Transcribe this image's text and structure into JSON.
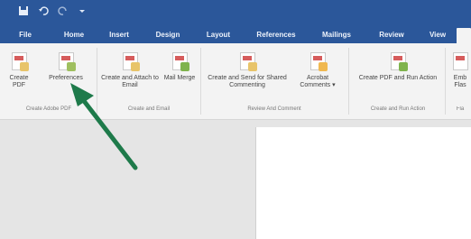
{
  "window": {
    "qat_icons": [
      "save-icon",
      "undo-icon",
      "redo-icon",
      "customize-icon"
    ]
  },
  "tabs": [
    {
      "label": "File",
      "active": false
    },
    {
      "label": "Home",
      "active": false
    },
    {
      "label": "Insert",
      "active": false
    },
    {
      "label": "Design",
      "active": false
    },
    {
      "label": "Layout",
      "active": false
    },
    {
      "label": "References",
      "active": false
    },
    {
      "label": "Mailings",
      "active": false
    },
    {
      "label": "Review",
      "active": false
    },
    {
      "label": "View",
      "active": false
    },
    {
      "label": "",
      "active": true
    }
  ],
  "ribbon": {
    "buttons": {
      "create_pdf": "Create PDF",
      "preferences": "Preferences",
      "create_attach_email": "Create and Attach to Email",
      "mail_merge": "Mail Merge",
      "create_send_commenting": "Create and Send for Shared Commenting",
      "acrobat_comments": "Acrobat Comments ▾",
      "create_pdf_run_action": "Create PDF and Run Action",
      "embed_flash": "Emb Flas"
    },
    "groups": {
      "create_adobe_pdf": "Create Adobe PDF",
      "create_and_email": "Create and Email",
      "review_and_comment": "Review And Comment",
      "create_and_run_action": "Create and Run Action",
      "flash": "Fla"
    }
  },
  "colors": {
    "title_blue": "#2b579a",
    "arrow_green": "#1e7a4a"
  }
}
